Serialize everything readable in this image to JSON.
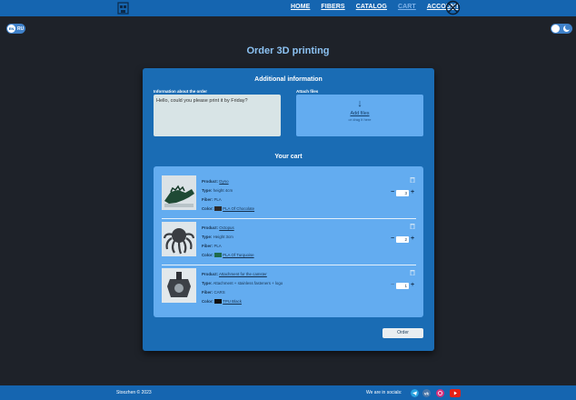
{
  "header": {
    "nav": [
      "HOME",
      "FIBERS",
      "CATALOG",
      "CART",
      "ACCOUNT"
    ],
    "active": "CART"
  },
  "lang": {
    "code": "RU",
    "badge": "EN"
  },
  "page": {
    "title": "Order 3D printing"
  },
  "additional": {
    "title": "Additional information",
    "info_label": "Information about the order",
    "info_value": "Hello, could you please print it by Friday?",
    "attach_label": "Attach files",
    "add_files": "Add files",
    "drag_hint": "or drag it here"
  },
  "cart": {
    "title": "Your cart",
    "labels": {
      "product": "Product:",
      "type": "Type:",
      "fiber": "Fiber:",
      "color": "Color:"
    },
    "items": [
      {
        "product": "Dyno",
        "type": "height 4cm",
        "fiber": "PLA",
        "color": "PLA Of Chocolate",
        "qty": "3",
        "swatch": "#2e2a28"
      },
      {
        "product": "Octopus",
        "type": "Height 3cm",
        "fiber": "PLA",
        "color": "PLA Of Turquoise",
        "qty": "2",
        "swatch": "#1f6b4c"
      },
      {
        "product": "Attachment for the camster",
        "type": "Attachment + stainless fasteners + logo",
        "fiber": "CARS",
        "color": "TPU Black",
        "qty": "1",
        "swatch": "#111111"
      }
    ]
  },
  "order_button": "Order",
  "footer": {
    "copyright": "Stoozhen © 2023",
    "socials_label": "We are in socials:"
  },
  "colors": {
    "topbar": "#1565b0",
    "card": "#1a6cb4",
    "cart_panel": "#63acf0",
    "title": "#8cc2f2"
  }
}
